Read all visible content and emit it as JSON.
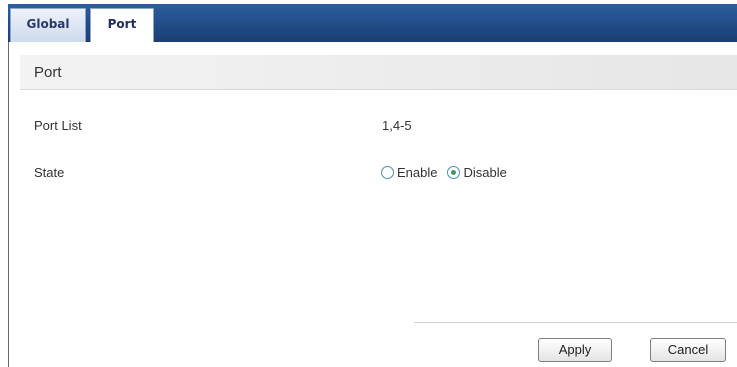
{
  "tabs": [
    {
      "label": "Global",
      "active": false
    },
    {
      "label": "Port",
      "active": true
    }
  ],
  "section": {
    "title": "Port"
  },
  "fields": {
    "port_list": {
      "label": "Port List",
      "value": "1,4-5"
    },
    "state": {
      "label": "State",
      "options": [
        {
          "label": "Enable",
          "checked": false
        },
        {
          "label": "Disable",
          "checked": true
        }
      ]
    }
  },
  "buttons": {
    "apply": "Apply",
    "cancel": "Cancel"
  },
  "colors": {
    "tabbar": "#1f4a86",
    "radio_checked": "#3b9a68"
  }
}
